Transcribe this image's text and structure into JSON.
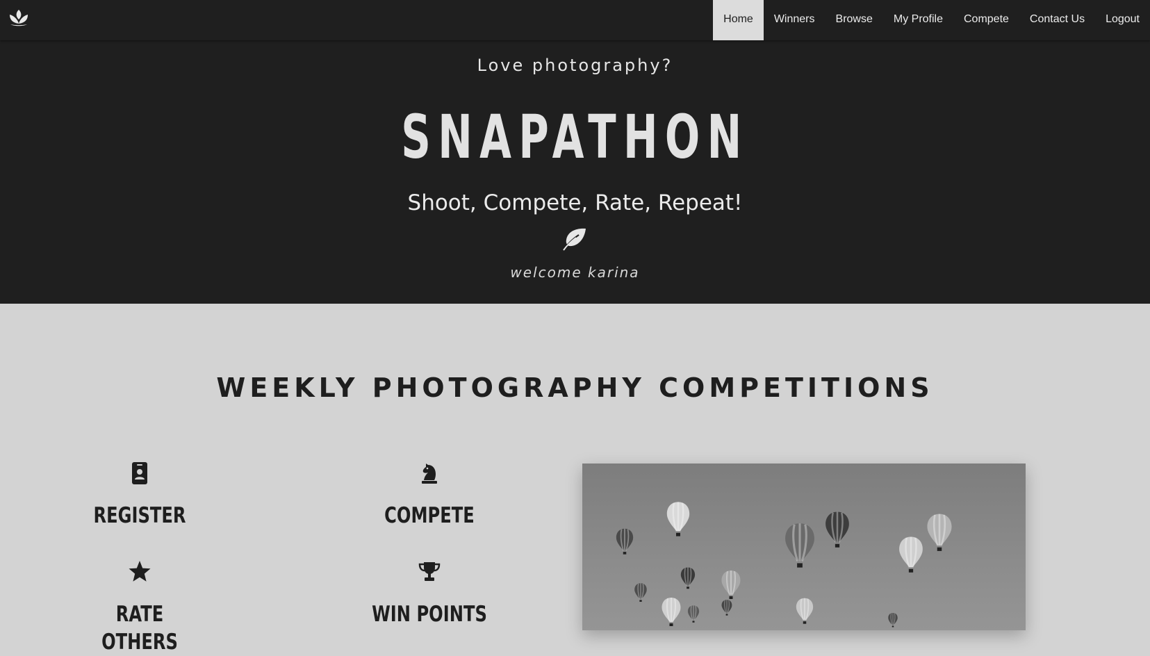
{
  "nav": {
    "logo_icon": "lotus-icon",
    "links": [
      "Home",
      "Winners",
      "Browse",
      "My Profile",
      "Compete",
      "Contact Us",
      "Logout"
    ],
    "active": "Home"
  },
  "hero": {
    "kicker": "Love photography?",
    "title": "SNAPATHON",
    "tagline": "Shoot, Compete, Rate, Repeat!",
    "divider_icon": "leaf-icon",
    "welcome": "welcome karina"
  },
  "main": {
    "section_title": "WEEKLY PHOTOGRAPHY COMPETITIONS",
    "features": [
      {
        "label": "REGISTER",
        "icon": "id-badge-icon"
      },
      {
        "label": "COMPETE",
        "icon": "chess-knight-icon"
      },
      {
        "label": "RATE OTHERS",
        "icon": "star-icon"
      },
      {
        "label": "WIN POINTS",
        "icon": "trophy-icon"
      }
    ],
    "photo": "hot-air-balloons-photo"
  },
  "colors": {
    "dark": "#1f1f1f",
    "light": "#d3d3d3",
    "active_tab": "#dcdcdc"
  }
}
